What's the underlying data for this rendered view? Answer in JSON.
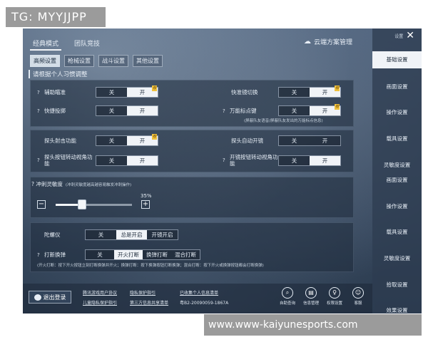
{
  "watermark_top": "TG: MYYJJPP",
  "watermark_bottom": "www.www-kaiyunesports.com",
  "mode_tabs": [
    "经典模式",
    "团队竞技"
  ],
  "cloud_label": "云端方案管理",
  "sub_tabs": [
    "高频设置",
    "枪械设置",
    "战斗设置",
    "其他设置"
  ],
  "hint": "请根据个人习惯调整",
  "toggle": {
    "off": "关",
    "on": "开"
  },
  "settings": {
    "aim_assist": "辅助瞄准",
    "quick_scope": "快捷投掷",
    "scope_switch": "快准镜切换",
    "universal_mark": "万能标点键",
    "universal_mark_note": "(屏蔽队友语音/屏蔽队友发出的万能标点信息)",
    "peek_fire": "探头射击功能",
    "peek_auto_scope": "探头自动开镜",
    "peek_rotate": "探头按钮转动视角功能",
    "scope_rotate": "开镜按钮转动视角功能"
  },
  "sensitivity": {
    "title": "冲刺灵敏度",
    "note": "(冲刺灵敏度越高越容易触发冲刺操作)",
    "value": "35%",
    "fraction": 0.35,
    "minus": "−",
    "plus": "+"
  },
  "gyro": {
    "label": "陀螺仪",
    "options": [
      "关",
      "总是开启",
      "开镜开启"
    ]
  },
  "fire_mode": {
    "label": "打新换弹",
    "options": [
      "关",
      "开火打断",
      "换弹打断",
      "混合打断"
    ],
    "note": "(开火打断：按下开火按钮立刻打断换弹并开火；换弹打断：按下换弹按钮打断换弹；混合打断：按下开火或换弹按钮都会打断换弹)"
  },
  "sidebar": {
    "mini": "设置",
    "items": [
      "基础设置",
      "画面设置",
      "操作设置",
      "载具设置",
      "灵敏度设置",
      "画面设置",
      "操作设置",
      "载具设置",
      "灵敏度设置",
      "拾取设置",
      "效果设置"
    ]
  },
  "bottom": {
    "exit": "退出登录",
    "links": [
      "腾讯游戏用户协议",
      "隐私保护指引",
      "已收集个人信息清单",
      "儿童隐私保护指引",
      "第三方信息共享清单",
      "粤B2-20090059-1867A"
    ],
    "tools": [
      {
        "icon": "search-icon",
        "glyph": "⌕",
        "label": "自助查询"
      },
      {
        "icon": "info-manage-icon",
        "glyph": "▤",
        "label": "信息管理"
      },
      {
        "icon": "permission-icon",
        "glyph": "♀",
        "label": "权限设置"
      },
      {
        "icon": "service-icon",
        "glyph": "☺",
        "label": "客服"
      }
    ]
  }
}
